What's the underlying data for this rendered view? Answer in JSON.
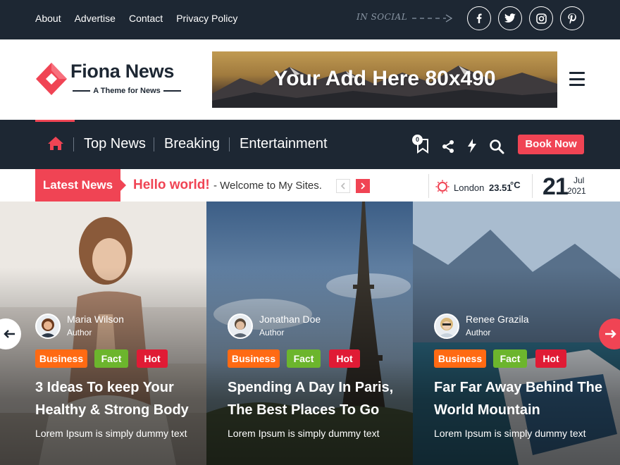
{
  "topbar": {
    "links": [
      "About",
      "Advertise",
      "Contact",
      "Privacy Policy"
    ],
    "social_label": "IN SOCIAL",
    "social_icons": [
      "facebook-icon",
      "twitter-icon",
      "instagram-icon",
      "pinterest-icon"
    ]
  },
  "header": {
    "brand": "Fiona News",
    "tagline": "A Theme for News",
    "ad_text": "Your Add Here 80x490"
  },
  "nav": {
    "items": [
      "Top News",
      "Breaking",
      "Entertainment"
    ],
    "bookmark_count": "0",
    "book_button": "Book Now"
  },
  "ticker": {
    "label": "Latest News",
    "title": "Hello world!",
    "subtitle": "- Welcome to My Sites.",
    "weather": {
      "city": "London",
      "temp": "23.51",
      "unit": "°C"
    },
    "date": {
      "day": "21",
      "month": "Jul",
      "year": "2021"
    }
  },
  "slides": [
    {
      "author": "Maria Wilson",
      "role": "Author",
      "tags": [
        "Business",
        "Fact",
        "Hot"
      ],
      "title_lines": [
        "3 Ideas To keep Your",
        "Healthy & Strong Body"
      ],
      "excerpt": "Lorem Ipsum is simply dummy text"
    },
    {
      "author": "Jonathan Doe",
      "role": "Author",
      "tags": [
        "Business",
        "Fact",
        "Hot"
      ],
      "title_lines": [
        "Spending A Day In Paris,",
        "The Best Places To Go"
      ],
      "excerpt": "Lorem Ipsum is simply dummy text"
    },
    {
      "author": "Renee Grazila",
      "role": "Author",
      "tags": [
        "Business",
        "Fact",
        "Hot"
      ],
      "title_lines": [
        "Far Far Away Behind The",
        "World Mountain"
      ],
      "excerpt": "Lorem Ipsum is simply dummy text"
    }
  ],
  "colors": {
    "accent": "#f04454",
    "dark": "#1d2733",
    "tag_business": "#ff6a13",
    "tag_fact": "#6cb52d",
    "tag_hot": "#e01b35"
  }
}
